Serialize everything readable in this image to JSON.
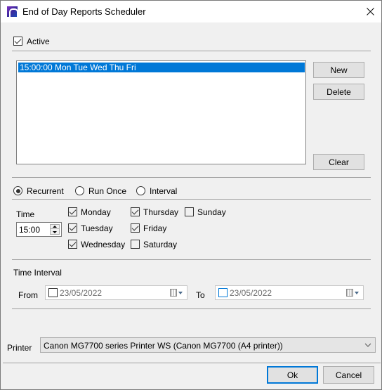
{
  "window": {
    "title": "End of Day Reports Scheduler",
    "icon": "app-logo-icon",
    "close_icon": "close-icon"
  },
  "active": {
    "label": "Active",
    "checked": true
  },
  "schedule_list": {
    "items": [
      {
        "text": "15:00:00 Mon Tue Wed Thu Fri",
        "selected": true
      }
    ]
  },
  "buttons": {
    "new": "New",
    "delete": "Delete",
    "clear": "Clear",
    "ok": "Ok",
    "cancel": "Cancel"
  },
  "mode": {
    "options": [
      {
        "label": "Recurrent",
        "selected": true
      },
      {
        "label": "Run Once",
        "selected": false
      },
      {
        "label": "Interval",
        "selected": false
      }
    ]
  },
  "time": {
    "label": "Time",
    "value": "15:00"
  },
  "days": [
    {
      "label": "Monday",
      "checked": true
    },
    {
      "label": "Tuesday",
      "checked": true
    },
    {
      "label": "Wednesday",
      "checked": true
    },
    {
      "label": "Thursday",
      "checked": true
    },
    {
      "label": "Friday",
      "checked": true
    },
    {
      "label": "Saturday",
      "checked": false
    },
    {
      "label": "Sunday",
      "checked": false
    }
  ],
  "time_interval": {
    "heading": "Time Interval",
    "from_label": "From",
    "from_value": "23/05/2022",
    "from_checked": false,
    "to_label": "To",
    "to_value": "23/05/2022",
    "to_checked": false
  },
  "printer": {
    "label": "Printer",
    "selected": "Canon MG7700 series Printer WS (Canon MG7700 (A4 printer))"
  },
  "colors": {
    "accent": "#0078d7",
    "window_bg": "#f0f0f0",
    "selection_bg": "#0078d7"
  }
}
